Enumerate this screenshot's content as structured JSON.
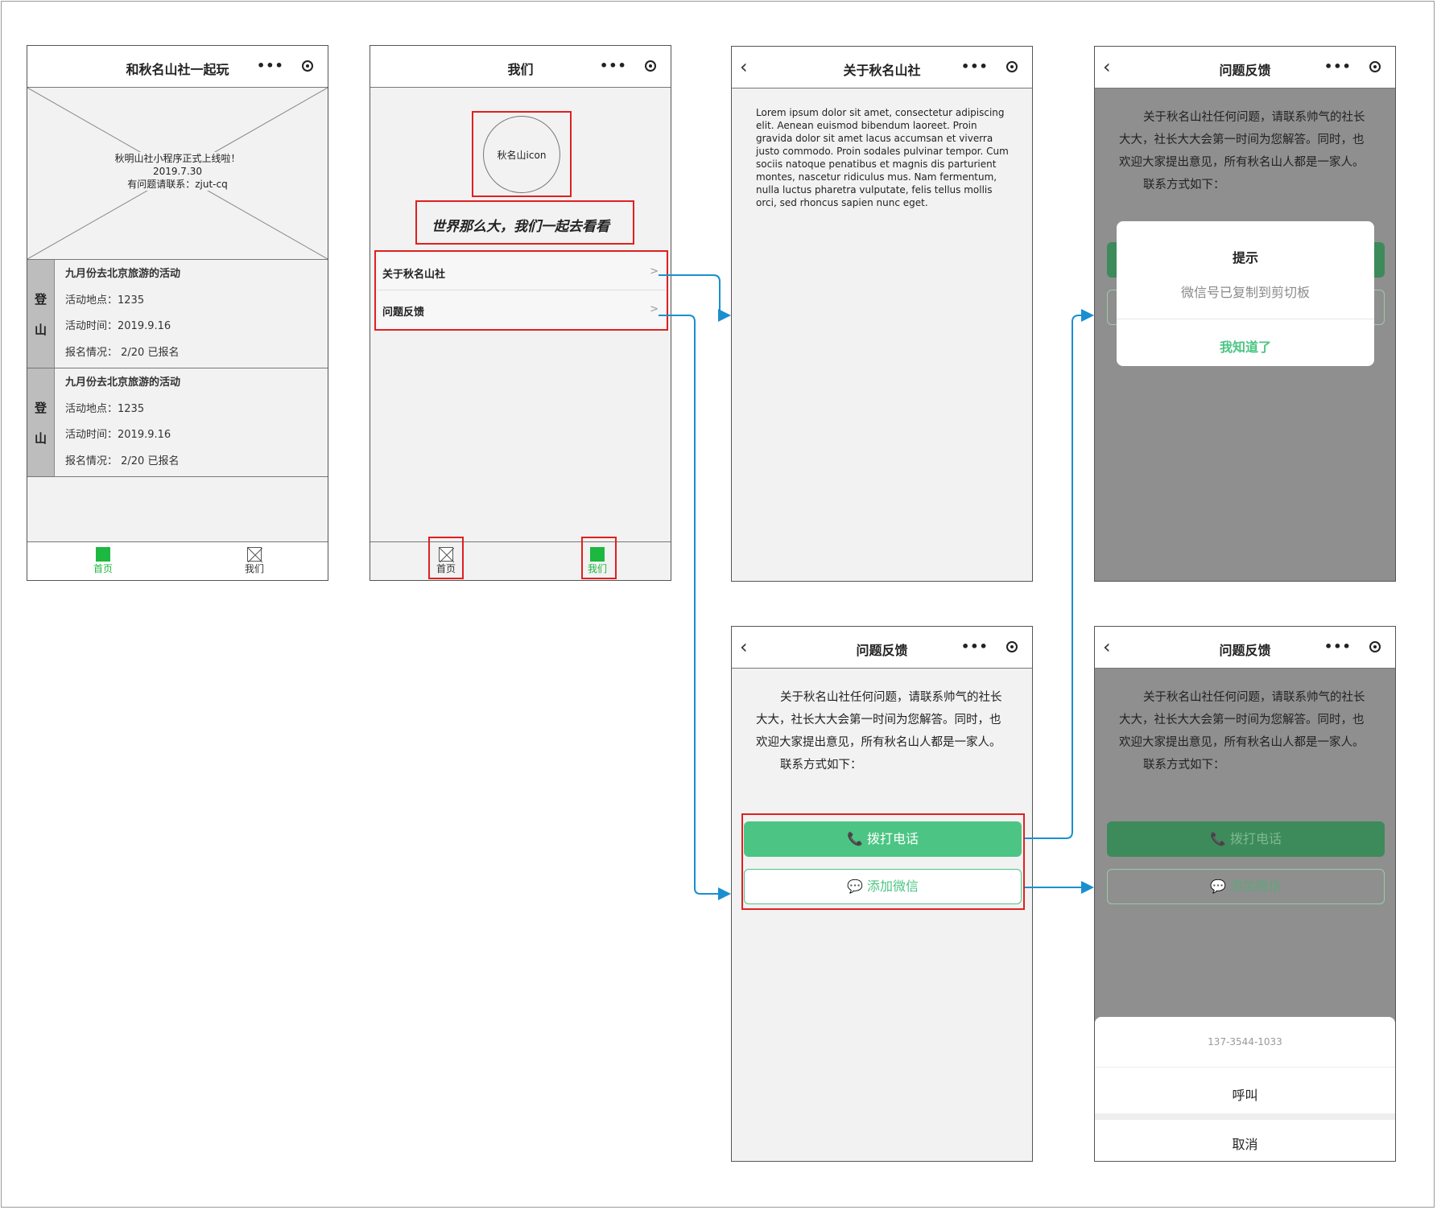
{
  "screen_home": {
    "title": "和秋名山社一起玩",
    "banner_lines": [
      "秋明山社小程序正式上线啦！",
      "2019.7.30",
      "有问题请联系：zjut-cq"
    ],
    "activities": [
      {
        "tag_chars": [
          "登",
          "山"
        ],
        "title": "九月份去北京旅游的活动",
        "location": "活动地点：1235",
        "time": "活动时间：2019.9.16",
        "signup": "报名情况：  2/20  已报名"
      },
      {
        "tag_chars": [
          "登",
          "山"
        ],
        "title": "九月份去北京旅游的活动",
        "location": "活动地点：1235",
        "time": "活动时间：2019.9.16",
        "signup": "报名情况：  2/20  已报名"
      }
    ],
    "tabs": {
      "home": "首页",
      "us": "我们"
    }
  },
  "screen_us": {
    "title": "我们",
    "avatar_label": "秋名山icon",
    "slogan": "世界那么大，我们一起去看看",
    "menu": [
      {
        "label": "关于秋名山社",
        "arrow": ">"
      },
      {
        "label": "问题反馈",
        "arrow": ">"
      }
    ],
    "tabs": {
      "home": "首页",
      "us": "我们"
    }
  },
  "screen_about": {
    "title": "关于秋名山社",
    "body": "Lorem ipsum dolor sit amet, consectetur adipiscing elit. Aenean euismod bibendum laoreet. Proin gravida dolor sit amet lacus accumsan et viverra justo commodo. Proin sodales pulvinar tempor. Cum sociis natoque penatibus et magnis dis parturient montes, nascetur ridiculus mus. Nam fermentum, nulla luctus pharetra vulputate, felis tellus mollis orci, sed rhoncus sapien nunc eget."
  },
  "feedback": {
    "title": "问题反馈",
    "paragraph1": "关于秋名山社任何问题，请联系帅气的社长大大，社长大大会第一时间为您解答。同时，也欢迎大家提出意见，所有秋名山人都是一家人。",
    "paragraph2": "联系方式如下：",
    "call_label": "拨打电话",
    "wechat_label": "添加微信"
  },
  "dialog": {
    "title": "提示",
    "message": "微信号已复制到剪切板",
    "confirm": "我知道了"
  },
  "action_sheet": {
    "phone": "137-3544-1033",
    "call": "呼叫",
    "cancel": "取消"
  },
  "colors": {
    "accent_green": "#4cc584",
    "tab_green": "#1db83f",
    "highlight_red": "#e02020",
    "connector_blue": "#1a8fd0",
    "overlay_gray": "#8f8f8f"
  }
}
